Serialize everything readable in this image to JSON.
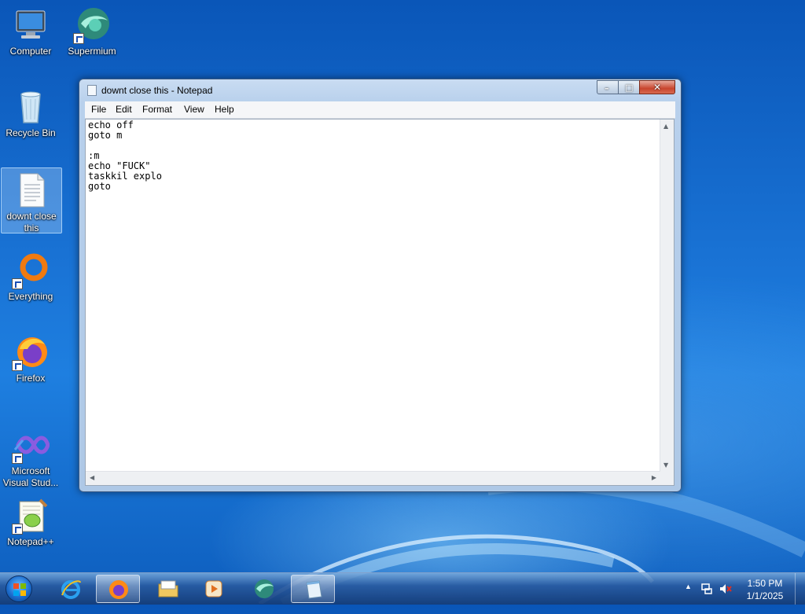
{
  "desktop": {
    "icons": [
      {
        "label": "Computer"
      },
      {
        "label": "Supermium"
      },
      {
        "label": "Recycle Bin"
      },
      {
        "label": "downt close this"
      },
      {
        "label": "Everything"
      },
      {
        "label": "Firefox"
      },
      {
        "label": "Microsoft Visual Stud..."
      },
      {
        "label": "Notepad++"
      }
    ]
  },
  "window": {
    "title": "downt close this - Notepad",
    "menu": [
      "File",
      "Edit",
      "Format",
      "View",
      "Help"
    ],
    "content": "echo off\ngoto m\n\n:m\necho \"FUCK\"\ntaskkil explo\ngoto"
  },
  "taskbar": {
    "items": [
      "start-orb-icon",
      "internet-explorer-icon",
      "firefox-icon",
      "file-explorer-icon",
      "media-player-icon",
      "supermium-icon",
      "notepad-icon"
    ],
    "clock": {
      "time": "1:50 PM",
      "date": "1/1/2025"
    }
  },
  "colors": {
    "accent": "#1a74d6",
    "close": "#c8452e"
  }
}
